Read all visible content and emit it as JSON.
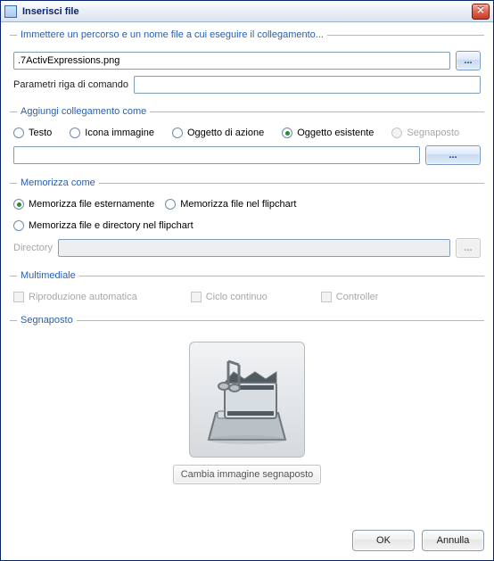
{
  "window": {
    "title": "Inserisci file"
  },
  "path_group": {
    "legend": "Immettere un percorso e un nome file a cui eseguire il collegamento...",
    "file_value": ".7ActivExpressions.png",
    "browse_label": "...",
    "params_label": "Parametri riga di comando",
    "params_value": ""
  },
  "link_group": {
    "legend": "Aggiungi collegamento come",
    "options": {
      "text": "Testo",
      "image_icon": "Icona immagine",
      "action_object": "Oggetto di azione",
      "existing_object": "Oggetto esistente",
      "placeholder": "Segnaposto"
    },
    "selected": "existing_object",
    "object_value": "",
    "object_browse_label": "..."
  },
  "store_group": {
    "legend": "Memorizza come",
    "options": {
      "external": "Memorizza file esternamente",
      "in_flipchart": "Memorizza file nel flipchart",
      "dir_in_flipchart": "Memorizza file e directory nel flipchart"
    },
    "selected": "external",
    "directory_label": "Directory",
    "directory_value": "",
    "directory_browse_label": "..."
  },
  "multimedia_group": {
    "legend": "Multimediale",
    "options": {
      "autoplay": "Riproduzione automatica",
      "loop": "Ciclo continuo",
      "controller": "Controller"
    }
  },
  "placeholder_group": {
    "legend": "Segnaposto",
    "change_button": "Cambia immagine segnaposto"
  },
  "dialog_buttons": {
    "ok": "OK",
    "cancel": "Annulla"
  }
}
